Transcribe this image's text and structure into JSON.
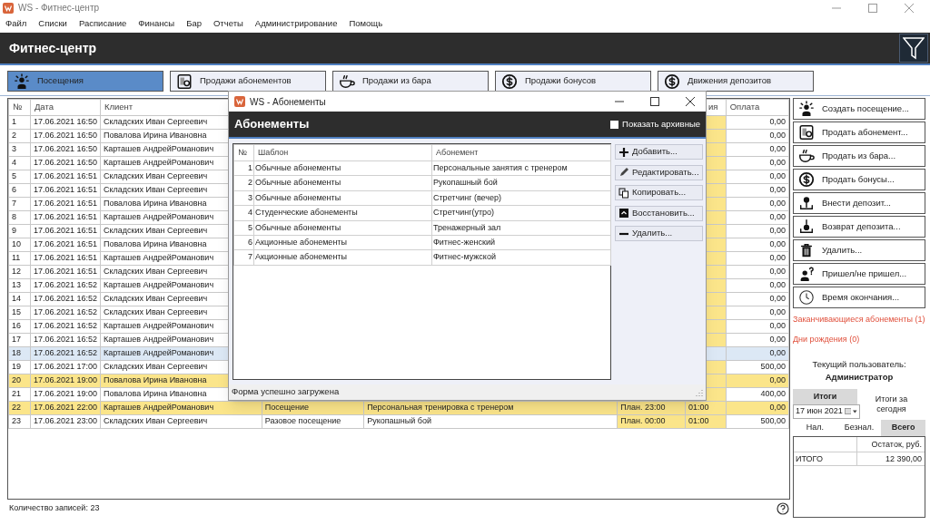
{
  "window": {
    "title": "WS - Фитнес-центр"
  },
  "menu": [
    "Файл",
    "Списки",
    "Расписание",
    "Финансы",
    "Бар",
    "Отчеты",
    "Администрирование",
    "Помощь"
  ],
  "header": {
    "title": "Фитнес-центр"
  },
  "tabs": [
    {
      "label": "Посещения",
      "selected": true
    },
    {
      "label": "Продажи абонементов",
      "selected": false
    },
    {
      "label": "Продажи из бара",
      "selected": false
    },
    {
      "label": "Продажи бонусов",
      "selected": false
    },
    {
      "label": "Движения депозитов",
      "selected": false
    }
  ],
  "table": {
    "columns": {
      "number": "№",
      "date": "Дата",
      "client": "Клиент",
      "column_7": "ия",
      "payment": "Оплата"
    },
    "rows": [
      {
        "number": "1",
        "date": "17.06.2021 16:50",
        "client": "Складских Иван Сергеевич",
        "payment": "0,00",
        "selected": false,
        "highlighted": false
      },
      {
        "number": "2",
        "date": "17.06.2021 16:50",
        "client": "Повалова Ирина Ивановна",
        "payment": "0,00",
        "selected": false,
        "highlighted": false
      },
      {
        "number": "3",
        "date": "17.06.2021 16:50",
        "client": "Карташев АндрейРоманович",
        "payment": "0,00",
        "selected": false,
        "highlighted": false
      },
      {
        "number": "4",
        "date": "17.06.2021 16:50",
        "client": "Карташев АндрейРоманович",
        "payment": "0,00",
        "selected": false,
        "highlighted": false
      },
      {
        "number": "5",
        "date": "17.06.2021 16:51",
        "client": "Складских Иван Сергеевич",
        "payment": "0,00",
        "selected": false,
        "highlighted": false
      },
      {
        "number": "6",
        "date": "17.06.2021 16:51",
        "client": "Складских Иван Сергеевич",
        "payment": "0,00",
        "selected": false,
        "highlighted": false
      },
      {
        "number": "7",
        "date": "17.06.2021 16:51",
        "client": "Повалова Ирина Ивановна",
        "payment": "0,00",
        "selected": false,
        "highlighted": false
      },
      {
        "number": "8",
        "date": "17.06.2021 16:51",
        "client": "Карташев АндрейРоманович",
        "payment": "0,00",
        "selected": false,
        "highlighted": false
      },
      {
        "number": "9",
        "date": "17.06.2021 16:51",
        "client": "Складских Иван Сергеевич",
        "payment": "0,00",
        "selected": false,
        "highlighted": false
      },
      {
        "number": "10",
        "date": "17.06.2021 16:51",
        "client": "Повалова Ирина Ивановна",
        "payment": "0,00",
        "selected": false,
        "highlighted": false
      },
      {
        "number": "11",
        "date": "17.06.2021 16:51",
        "client": "Карташев АндрейРоманович",
        "payment": "0,00",
        "selected": false,
        "highlighted": false
      },
      {
        "number": "12",
        "date": "17.06.2021 16:51",
        "client": "Складских Иван Сергеевич",
        "payment": "0,00",
        "selected": false,
        "highlighted": false
      },
      {
        "number": "13",
        "date": "17.06.2021 16:52",
        "client": "Карташев АндрейРоманович",
        "payment": "0,00",
        "selected": false,
        "highlighted": false
      },
      {
        "number": "14",
        "date": "17.06.2021 16:52",
        "client": "Складских Иван Сергеевич",
        "payment": "0,00",
        "selected": false,
        "highlighted": false
      },
      {
        "number": "15",
        "date": "17.06.2021 16:52",
        "client": "Складских Иван Сергеевич",
        "payment": "0,00",
        "selected": false,
        "highlighted": false
      },
      {
        "number": "16",
        "date": "17.06.2021 16:52",
        "client": "Карташев АндрейРоманович",
        "payment": "0,00",
        "selected": false,
        "highlighted": false
      },
      {
        "number": "17",
        "date": "17.06.2021 16:52",
        "client": "Карташев АндрейРоманович",
        "payment": "0,00",
        "selected": false,
        "highlighted": false
      },
      {
        "number": "18",
        "date": "17.06.2021 16:52",
        "client": "Карташев АндрейРоманович",
        "payment": "0,00",
        "selected": true,
        "highlighted": false
      },
      {
        "number": "19",
        "date": "17.06.2021 17:00",
        "client": "Складских Иван Сергеевич",
        "payment": "500,00",
        "selected": false,
        "highlighted": false
      },
      {
        "number": "20",
        "date": "17.06.2021 19:00",
        "client": "Повалова Ирина Ивановна",
        "payment": "0,00",
        "selected": false,
        "highlighted": true
      },
      {
        "number": "21",
        "date": "17.06.2021 19:00",
        "client": "Повалова Ирина Ивановна",
        "payment": "400,00",
        "selected": false,
        "highlighted": false
      },
      {
        "number": "22",
        "date": "17.06.2021 22:00",
        "client": "Карташев АндрейРоманович",
        "column_4": "Посещение",
        "column_5": "Персональная тренировка с тренером",
        "column_6": "План. 23:00",
        "column_7": "01:00",
        "payment": "0,00",
        "selected": false,
        "highlighted": true
      },
      {
        "number": "23",
        "date": "17.06.2021 23:00",
        "client": "Складских Иван Сергеевич",
        "column_4": "Разовое посещение",
        "column_5": "Рукопашный бой",
        "column_6": "План. 00:00",
        "column_7": "01:00",
        "payment": "500,00",
        "selected": false,
        "highlighted": false
      }
    ]
  },
  "status_bar": {
    "record_count": "Количество записей: 23"
  },
  "sidebar": {
    "actions": [
      "Создать посещение...",
      "Продать абонемент...",
      "Продать из бара...",
      "Продать бонусы...",
      "Внести депозит...",
      "Возврат депозита...",
      "Удалить...",
      "Пришел/не пришел...",
      "Время окончания..."
    ],
    "alerts": [
      "Заканчивающиеся абонементы (1)",
      "Дни рождения (0)"
    ],
    "current_user": {
      "label": "Текущий пользователь:",
      "name": "Администратор"
    },
    "totals": {
      "tabs": [
        {
          "label": "Итоги",
          "selected": true
        },
        {
          "label": "Итоги за сегодня",
          "selected": false
        }
      ],
      "date": "17 июн 2021",
      "payment_tabs": [
        {
          "label": "Нал.",
          "selected": false
        },
        {
          "label": "Безнал.",
          "selected": false
        },
        {
          "label": "Всего",
          "selected": true
        }
      ],
      "column": "Остаток, руб.",
      "rows": [
        {
          "label": "ИТОГО",
          "value": "12 390,00"
        }
      ]
    }
  },
  "dialog": {
    "title": "WS - Абонементы",
    "header": "Абонементы",
    "show_archived": {
      "label": "Показать архивные",
      "checked": false
    },
    "columns": [
      "№",
      "Шаблон",
      "Абонемент"
    ],
    "rows": [
      {
        "number": "1",
        "template": "Обычные абонементы",
        "subscription": "Персональные занятия с тренером"
      },
      {
        "number": "2",
        "template": "Обычные абонементы",
        "subscription": "Рукопашный бой"
      },
      {
        "number": "3",
        "template": "Обычные абонементы",
        "subscription": "Стретчинг (вечер)"
      },
      {
        "number": "4",
        "template": "Студенческие абонементы",
        "subscription": "Стретчинг(утро)"
      },
      {
        "number": "5",
        "template": "Обычные абонементы",
        "subscription": "Тренажерный зал"
      },
      {
        "number": "6",
        "template": "Акционные абонементы",
        "subscription": "Фитнес-женский"
      },
      {
        "number": "7",
        "template": "Акционные абонементы",
        "subscription": "Фитнес-мужской"
      }
    ],
    "buttons": [
      "Добавить...",
      "Редактировать...",
      "Копировать...",
      "Восстановить...",
      "Удалить..."
    ],
    "status": "Форма успешно загружена"
  }
}
